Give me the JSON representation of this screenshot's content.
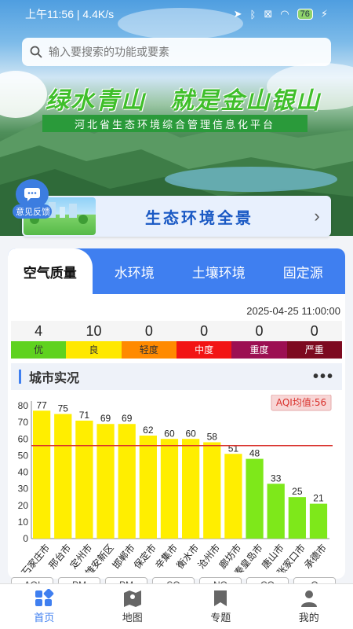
{
  "status": {
    "time": "上午11:56 | 4.4K/s",
    "battery": "76"
  },
  "search": {
    "placeholder": "输入要搜索的功能或要素"
  },
  "banner": {
    "slogan": "绿水青山   就是金山银山",
    "platform": "河北省生态环境综合管理信息化平台"
  },
  "feedback": {
    "label": "意见反馈"
  },
  "panorama": {
    "title": "生态环境全景"
  },
  "tabs": [
    "空气质量",
    "水环境",
    "土壤环境",
    "固定源"
  ],
  "datetime": "2025-04-25 11:00:00",
  "levels": [
    {
      "count": "4",
      "name": "优",
      "color": "#5fd21f"
    },
    {
      "count": "10",
      "name": "良",
      "color": "#ffe800"
    },
    {
      "count": "0",
      "name": "轻度",
      "color": "#ff8a00"
    },
    {
      "count": "0",
      "name": "中度",
      "color": "#f21414"
    },
    {
      "count": "0",
      "name": "重度",
      "color": "#9c0f52"
    },
    {
      "count": "0",
      "name": "严重",
      "color": "#7d0a20"
    }
  ],
  "section": {
    "title": "城市实况"
  },
  "chart_data": {
    "type": "bar",
    "categories": [
      "石家庄市",
      "邢台市",
      "定州市",
      "雄安新区",
      "邯郸市",
      "保定市",
      "辛集市",
      "衡水市",
      "沧州市",
      "廊坊市",
      "秦皇岛市",
      "唐山市",
      "张家口市",
      "承德市"
    ],
    "values": [
      77,
      75,
      71,
      69,
      69,
      62,
      60,
      60,
      58,
      51,
      48,
      33,
      25,
      21
    ],
    "ylim": [
      0,
      80
    ],
    "yticks": [
      0,
      10,
      20,
      30,
      40,
      50,
      60,
      70,
      80
    ],
    "avg_label": "AQI均值:56",
    "avg_value": 56,
    "good_color": "#7ee81a",
    "moderate_color": "#ffee00"
  },
  "pollutants": [
    "AQI",
    "PM",
    "PM",
    "SO",
    "NO",
    "CO",
    "O"
  ],
  "nav": [
    "首页",
    "地图",
    "专题",
    "我的"
  ]
}
